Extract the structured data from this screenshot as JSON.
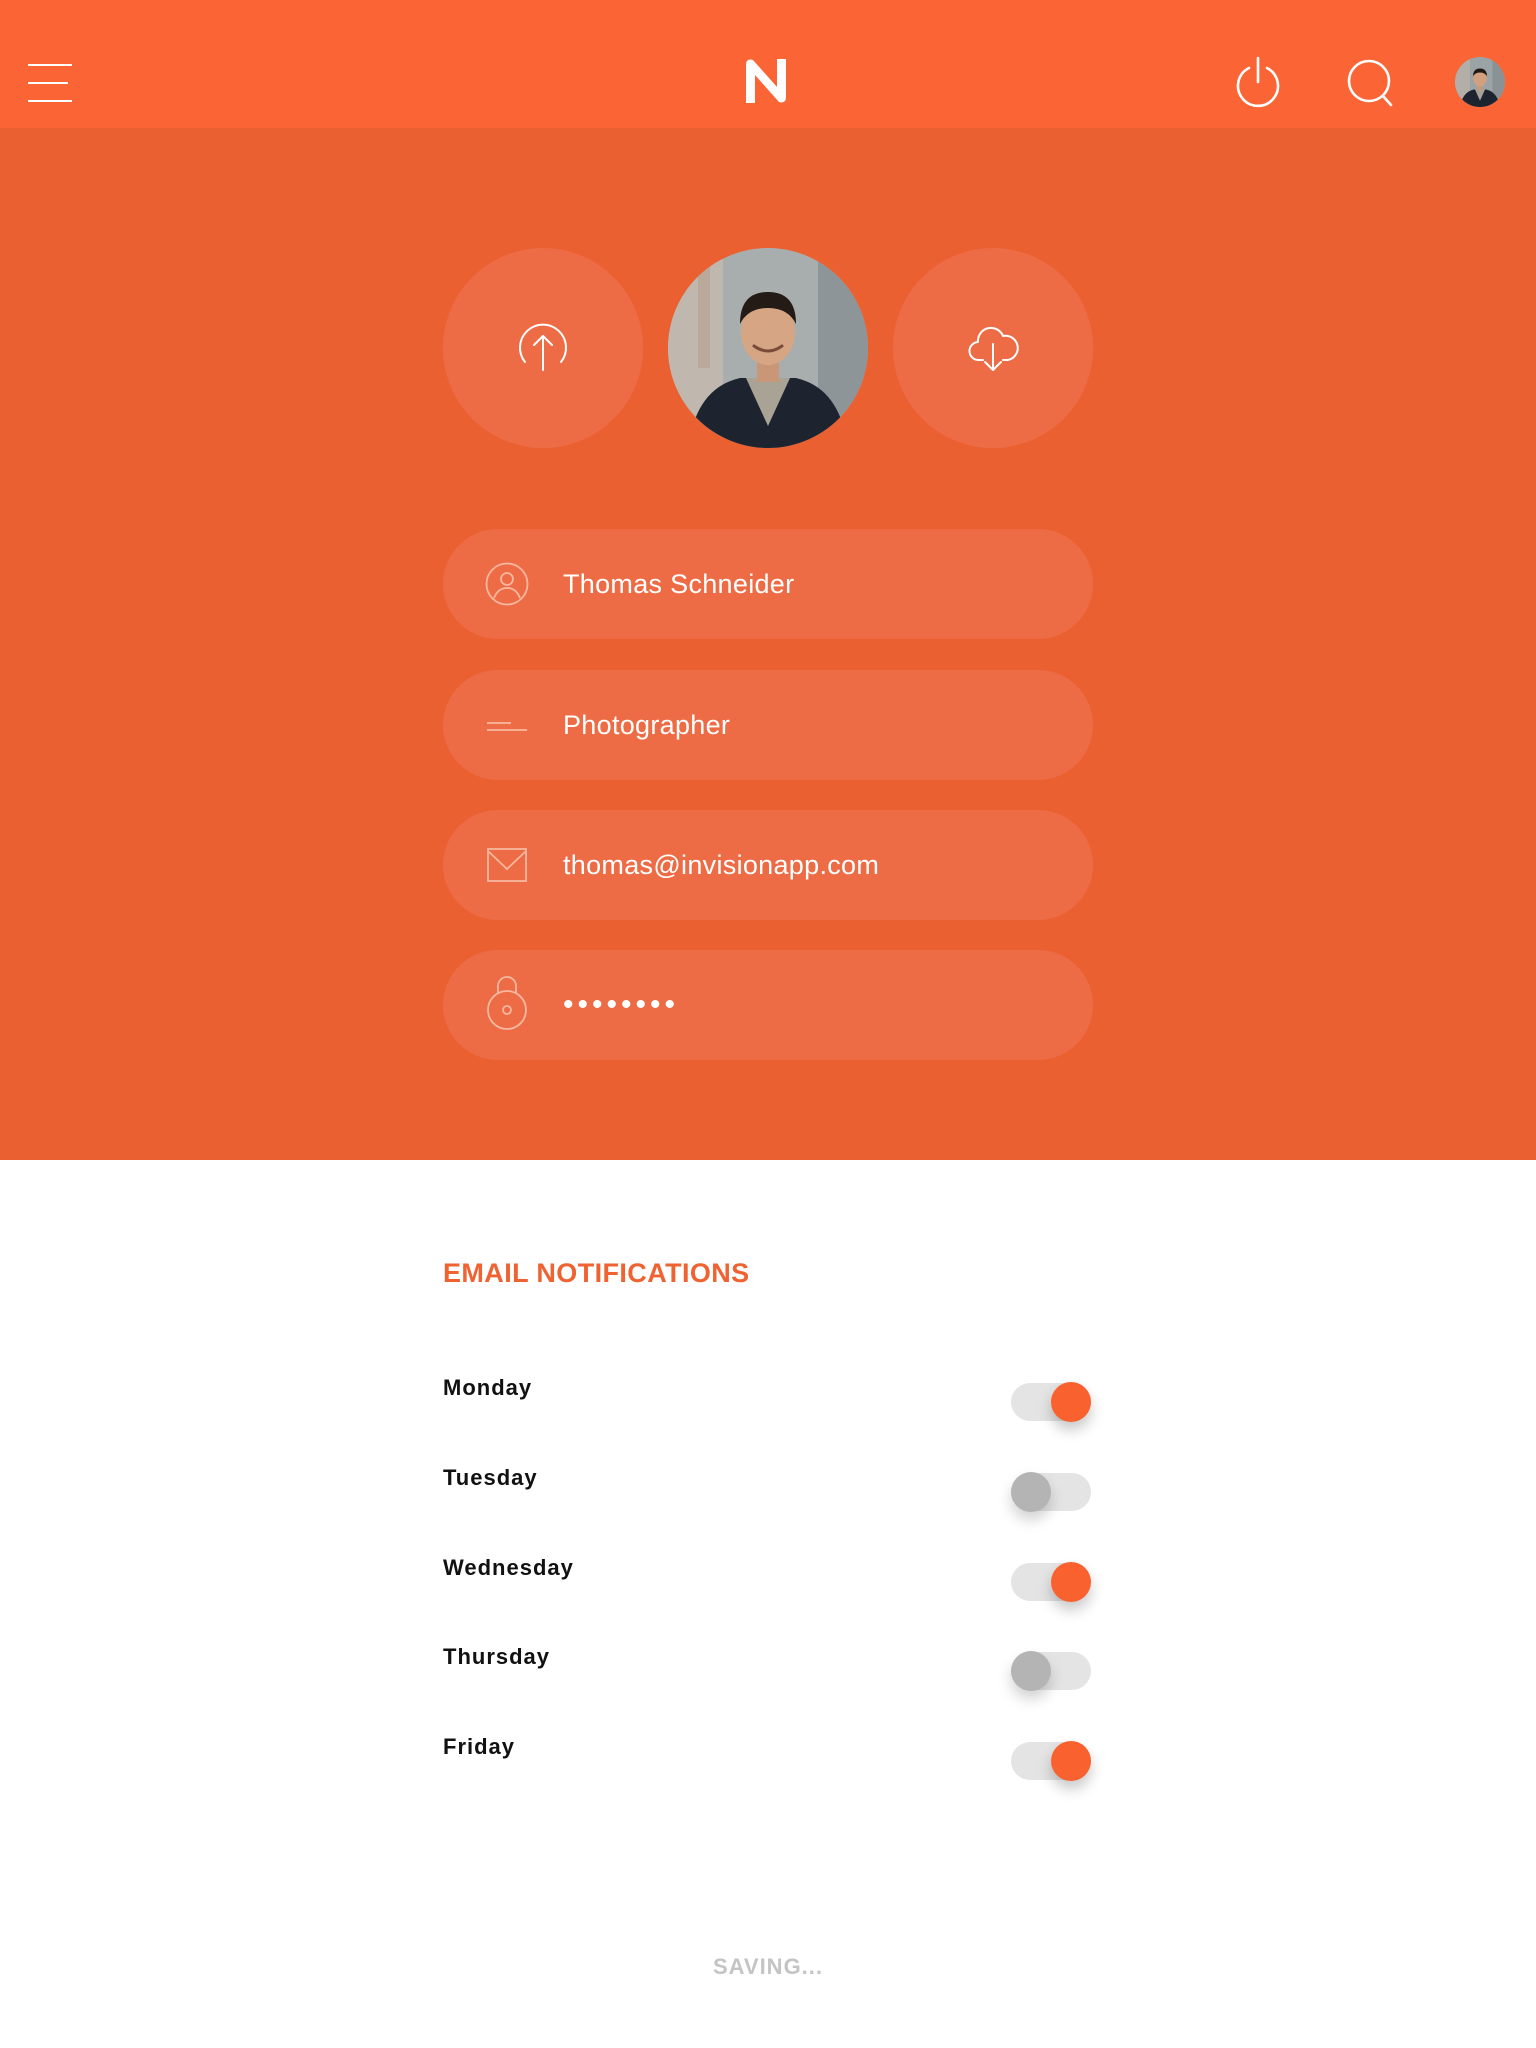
{
  "header": {
    "menu_icon": "hamburger-menu-icon",
    "logo_icon": "n-logo-icon",
    "power_icon": "power-icon",
    "search_icon": "search-icon",
    "avatar_icon": "user-avatar"
  },
  "profile": {
    "upload_icon": "upload-arrow-icon",
    "download_icon": "cloud-download-icon",
    "fields": [
      {
        "icon": "user-icon",
        "value": "Thomas Schneider"
      },
      {
        "icon": "lines-icon",
        "value": "Photographer"
      },
      {
        "icon": "envelope-icon",
        "value": "thomas@invisionapp.com"
      },
      {
        "icon": "lock-icon",
        "value": "••••••••"
      }
    ]
  },
  "notifications": {
    "title": "EMAIL NOTIFICATIONS",
    "days": [
      {
        "label": "Monday",
        "enabled": true
      },
      {
        "label": "Tuesday",
        "enabled": false
      },
      {
        "label": "Wednesday",
        "enabled": true
      },
      {
        "label": "Thursday",
        "enabled": false
      },
      {
        "label": "Friday",
        "enabled": true
      }
    ]
  },
  "status_text": "SAVING...",
  "colors": {
    "header": "#fb6435",
    "hero": "#eb6031",
    "field": "#ed6c45",
    "accent": "#ef6232",
    "toggle_on": "#f9622f",
    "toggle_off": "#b4b4b4",
    "status": "#c4c4c4"
  }
}
